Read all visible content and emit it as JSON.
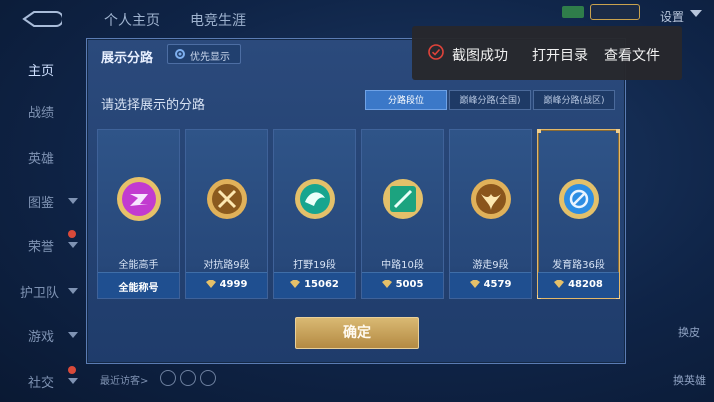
{
  "topbar": {
    "tabs": [
      "个人主页",
      "电竞生涯"
    ],
    "settings_label": "设置"
  },
  "sidebar": {
    "items": [
      {
        "label": "主页",
        "active": true
      },
      {
        "label": "战绩"
      },
      {
        "label": "英雄"
      },
      {
        "label": "图鉴"
      },
      {
        "label": "荣誉"
      },
      {
        "label": "护卫队"
      },
      {
        "label": "游戏"
      },
      {
        "label": "社交"
      }
    ]
  },
  "panel": {
    "title": "展示分路",
    "priority_label": "优先显示",
    "subtitle": "请选择展示的分路",
    "segments": [
      "分路段位",
      "巅峰分路(全国)",
      "巅峰分路(战区)"
    ],
    "active_segment": 0,
    "confirm_label": "确定"
  },
  "cards": [
    {
      "name": "全能高手",
      "value": "全能称号",
      "color": "#c23bd0",
      "show_gem": false
    },
    {
      "name": "对抗路9段",
      "value": "4999",
      "color": "#c58a2a",
      "show_gem": true
    },
    {
      "name": "打野19段",
      "value": "15062",
      "color": "#17a58f",
      "show_gem": true
    },
    {
      "name": "中路10段",
      "value": "5005",
      "color": "#1ca37f",
      "show_gem": true
    },
    {
      "name": "游走9段",
      "value": "4579",
      "color": "#c0842b",
      "show_gem": true
    },
    {
      "name": "发育路36段",
      "value": "48208",
      "color": "#2d8de3",
      "show_gem": true,
      "selected": true
    }
  ],
  "toast": {
    "status": "截图成功",
    "open_dir": "打开目录",
    "view_file": "查看文件"
  },
  "footer": {
    "recent_visitors": "最近访客>"
  },
  "right_hints": [
    "换皮",
    "换英雄"
  ],
  "colors": {
    "accent_gold": "#d9b973",
    "segment_active": "#3b78c8"
  }
}
